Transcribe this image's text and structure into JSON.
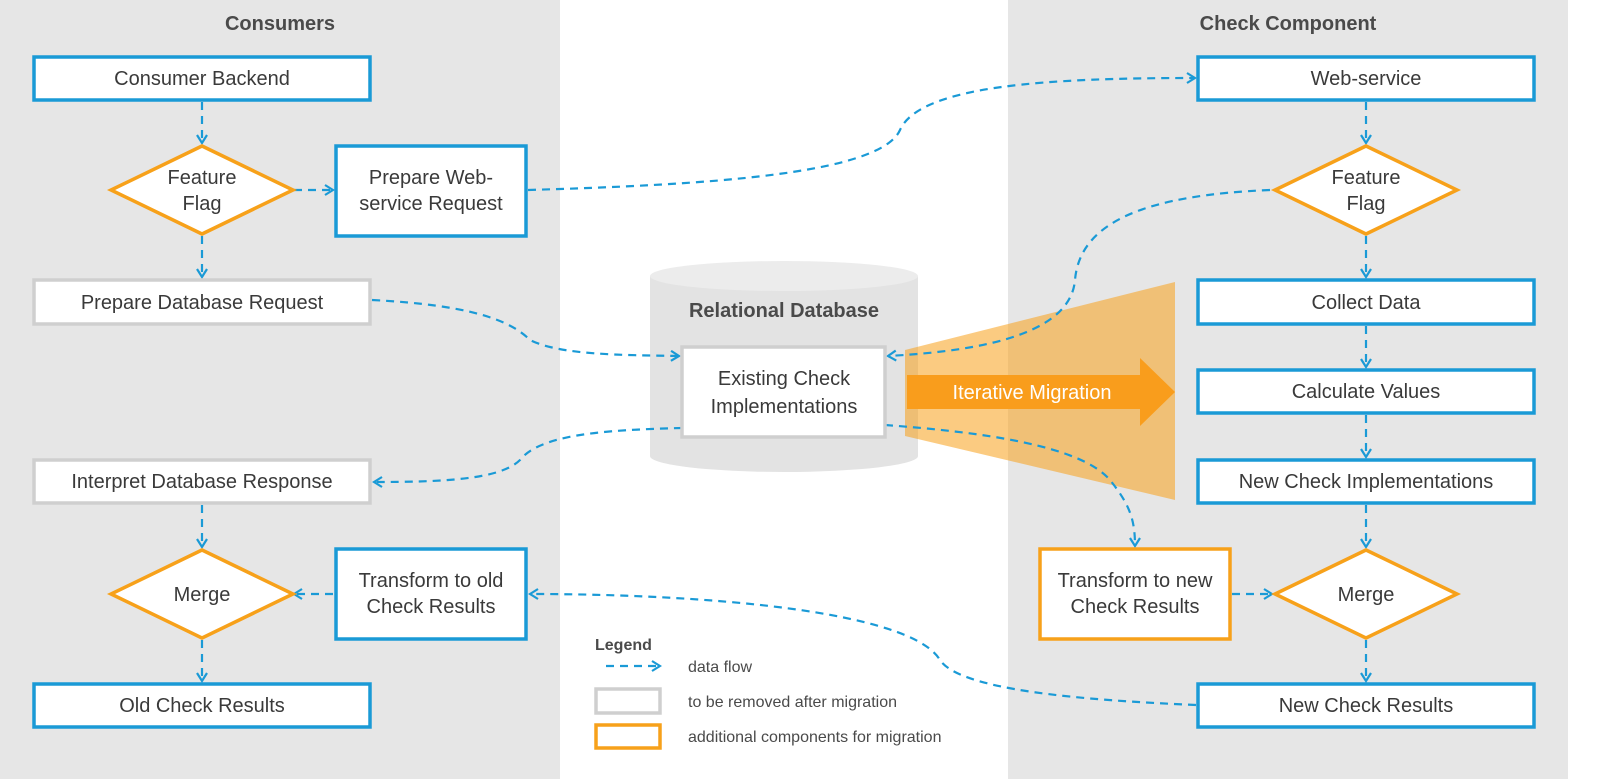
{
  "colors": {
    "flow": "#1a9ad6",
    "removed": "#cfcfcf",
    "additional": "#f7a11a",
    "migration": "#f99d1c",
    "panel": "#e6e6e6"
  },
  "consumers": {
    "title": "Consumers",
    "backend": "Consumer Backend",
    "feature_flag": [
      "Feature",
      "Flag"
    ],
    "prepare_ws": [
      "Prepare Web-",
      "service Request"
    ],
    "prepare_db": "Prepare Database Request",
    "interpret_db": "Interpret Database Response",
    "merge": "Merge",
    "transform_old": [
      "Transform to old",
      "Check Results"
    ],
    "old_results": "Old Check Results"
  },
  "database": {
    "title": "Relational Database",
    "existing": [
      "Existing Check",
      "Implementations"
    ]
  },
  "migration": {
    "label": "Iterative Migration"
  },
  "check": {
    "title": "Check Component",
    "webservice": "Web-service",
    "feature_flag": [
      "Feature",
      "Flag"
    ],
    "collect": "Collect Data",
    "calculate": "Calculate Values",
    "new_impl": "New Check Implementations",
    "transform_new": [
      "Transform to new",
      "Check Results"
    ],
    "merge": "Merge",
    "new_results": "New Check Results"
  },
  "legend": {
    "title": "Legend",
    "data_flow": "data flow",
    "removed": "to be removed after migration",
    "additional": "additional components for migration"
  }
}
